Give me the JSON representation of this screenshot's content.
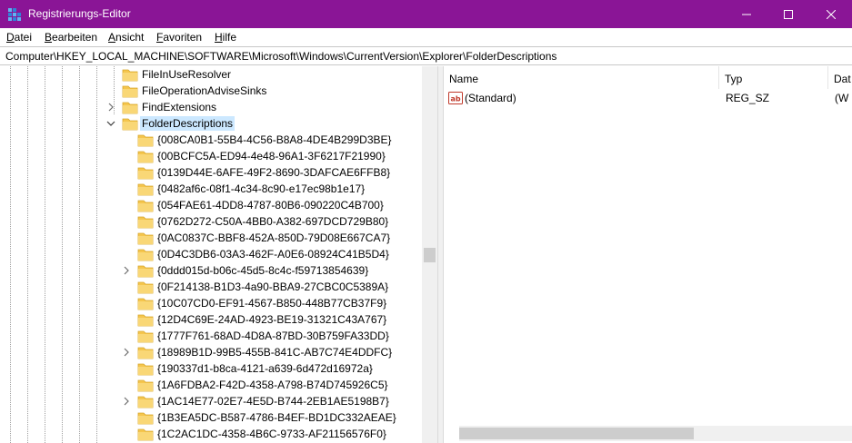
{
  "window": {
    "title": "Registrierungs-Editor",
    "accent_color": "#8a1596"
  },
  "menu": [
    {
      "label": "Datei",
      "accel": "D",
      "rest": "atei"
    },
    {
      "label": "Bearbeiten",
      "accel": "B",
      "rest": "earbeiten"
    },
    {
      "label": "Ansicht",
      "accel": "A",
      "rest": "nsicht"
    },
    {
      "label": "Favoriten",
      "accel": "F",
      "rest": "avoriten"
    },
    {
      "label": "Hilfe",
      "accel": "H",
      "rest": "ilfe"
    }
  ],
  "address": "Computer\\HKEY_LOCAL_MACHINE\\SOFTWARE\\Microsoft\\Windows\\CurrentVersion\\Explorer\\FolderDescriptions",
  "tree": {
    "parent_items": [
      {
        "label": "FileInUseResolver",
        "expander": "none"
      },
      {
        "label": "FileOperationAdviseSinks",
        "expander": "none"
      },
      {
        "label": "FindExtensions",
        "expander": "collapsed"
      },
      {
        "label": "FolderDescriptions",
        "expander": "expanded",
        "selected": true
      }
    ],
    "child_items": [
      {
        "label": "{008CA0B1-55B4-4C56-B8A8-4DE4B299D3BE}",
        "expander": "none"
      },
      {
        "label": "{00BCFC5A-ED94-4e48-96A1-3F6217F21990}",
        "expander": "none"
      },
      {
        "label": "{0139D44E-6AFE-49F2-8690-3DAFCAE6FFB8}",
        "expander": "none"
      },
      {
        "label": "{0482af6c-08f1-4c34-8c90-e17ec98b1e17}",
        "expander": "none"
      },
      {
        "label": "{054FAE61-4DD8-4787-80B6-090220C4B700}",
        "expander": "none"
      },
      {
        "label": "{0762D272-C50A-4BB0-A382-697DCD729B80}",
        "expander": "none"
      },
      {
        "label": "{0AC0837C-BBF8-452A-850D-79D08E667CA7}",
        "expander": "none"
      },
      {
        "label": "{0D4C3DB6-03A3-462F-A0E6-08924C41B5D4}",
        "expander": "none"
      },
      {
        "label": "{0ddd015d-b06c-45d5-8c4c-f59713854639}",
        "expander": "collapsed"
      },
      {
        "label": "{0F214138-B1D3-4a90-BBA9-27CBC0C5389A}",
        "expander": "none"
      },
      {
        "label": "{10C07CD0-EF91-4567-B850-448B77CB37F9}",
        "expander": "none"
      },
      {
        "label": "{12D4C69E-24AD-4923-BE19-31321C43A767}",
        "expander": "none"
      },
      {
        "label": "{1777F761-68AD-4D8A-87BD-30B759FA33DD}",
        "expander": "none"
      },
      {
        "label": "{18989B1D-99B5-455B-841C-AB7C74E4DDFC}",
        "expander": "collapsed"
      },
      {
        "label": "{190337d1-b8ca-4121-a639-6d472d16972a}",
        "expander": "none"
      },
      {
        "label": "{1A6FDBA2-F42D-4358-A798-B74D745926C5}",
        "expander": "none"
      },
      {
        "label": "{1AC14E77-02E7-4E5D-B744-2EB1AE5198B7}",
        "expander": "collapsed"
      },
      {
        "label": "{1B3EA5DC-B587-4786-B4EF-BD1DC332AEAE}",
        "expander": "none"
      },
      {
        "label": "{1C2AC1DC-4358-4B6C-9733-AF21156576F0}",
        "expander": "none"
      }
    ]
  },
  "values": {
    "columns": {
      "name": "Name",
      "type": "Typ",
      "data": "Dat"
    },
    "rows": [
      {
        "name": "(Standard)",
        "type": "REG_SZ",
        "data": "(W",
        "icon": "string-value-icon"
      }
    ]
  },
  "colors": {
    "folder": "#f5c64e",
    "selection": "#cce8ff",
    "scrollbar_track": "#f0f0f0",
    "scrollbar_thumb": "#cdcdcd"
  }
}
